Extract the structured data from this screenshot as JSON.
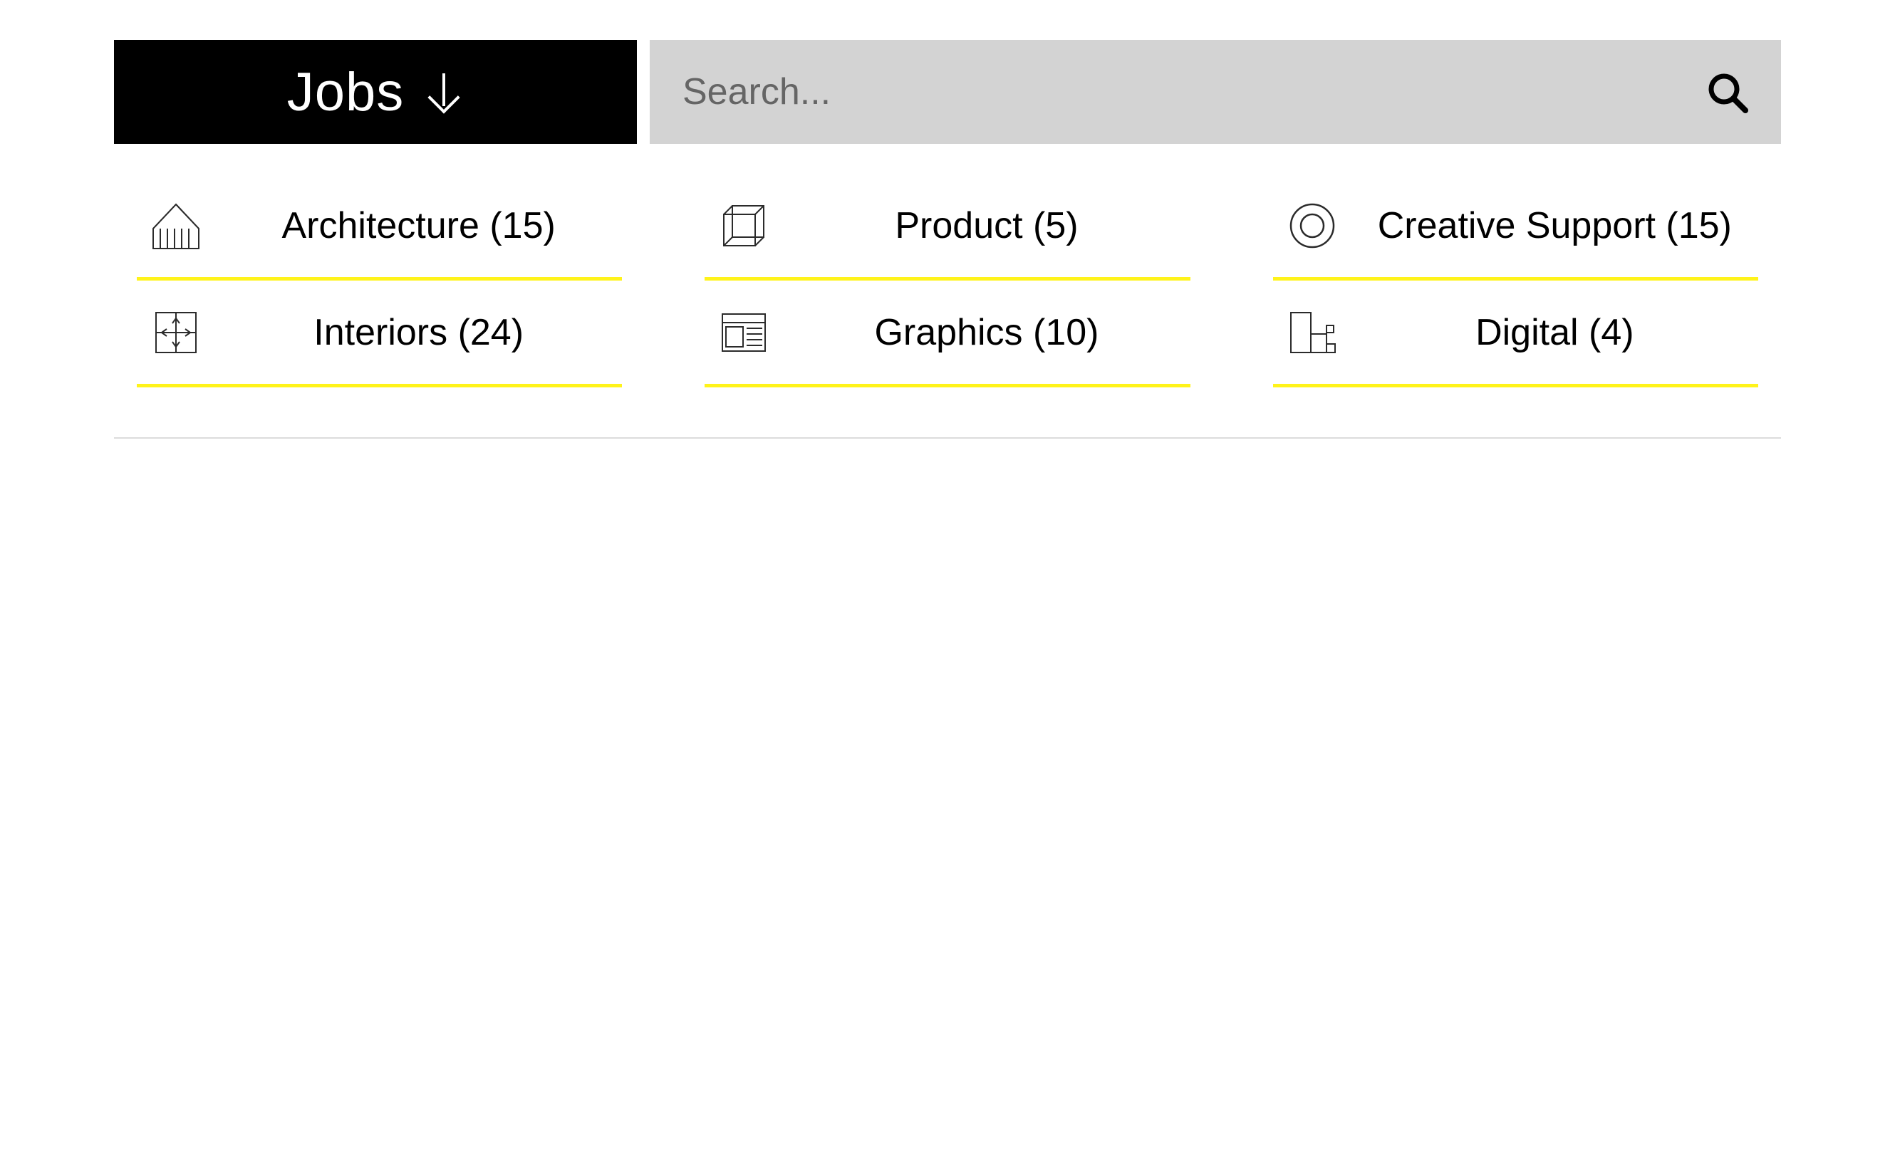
{
  "header": {
    "jobs_label": "Jobs",
    "search_placeholder": "Search..."
  },
  "categories": [
    {
      "icon": "architecture",
      "label": "Architecture (15)"
    },
    {
      "icon": "product",
      "label": "Product (5)"
    },
    {
      "icon": "creative",
      "label": "Creative Support (15)"
    },
    {
      "icon": "interiors",
      "label": "Interiors (24)"
    },
    {
      "icon": "graphics",
      "label": "Graphics (10)"
    },
    {
      "icon": "digital",
      "label": "Digital (4)"
    }
  ],
  "colors": {
    "accent_yellow": "#fff31a",
    "header_black": "#000000",
    "search_bg": "#d3d3d3"
  }
}
